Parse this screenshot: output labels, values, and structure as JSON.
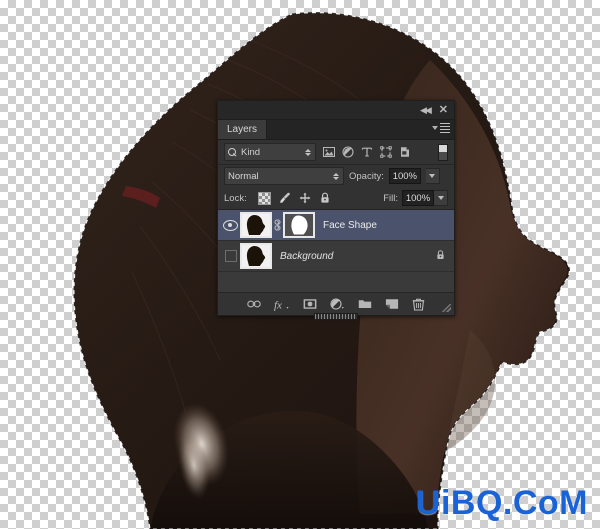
{
  "canvas": {
    "background": "transparent-checkerboard",
    "selection": "marching-ants",
    "subject": "woman-profile-silhouette",
    "watermark": "UiBQ.CoM",
    "watermark_color": "#1a63d6"
  },
  "panel": {
    "titlebar": {
      "collapse_label": "◀◀",
      "close_label": "✕"
    },
    "tab": {
      "label": "Layers"
    },
    "menu": {
      "label": "panel-menu"
    },
    "filter": {
      "kind_label": "Kind",
      "icons": [
        "pixel-layer-filter-icon",
        "adjustment-layer-filter-icon",
        "type-layer-filter-icon",
        "shape-layer-filter-icon",
        "smart-object-filter-icon"
      ],
      "toggle_label": "filter-enable-toggle"
    },
    "blend": {
      "mode": "Normal",
      "opacity_label": "Opacity:",
      "opacity_value": "100%"
    },
    "lock": {
      "label": "Lock:",
      "icons": [
        "lock-transparent-pixels-icon",
        "lock-image-pixels-icon",
        "lock-position-icon",
        "lock-all-icon"
      ],
      "fill_label": "Fill:",
      "fill_value": "100%"
    },
    "layers": [
      {
        "name": "Face Shape",
        "visible": true,
        "selected": true,
        "italic": false,
        "has_mask": true,
        "linked": true,
        "locked": false
      },
      {
        "name": "Background",
        "visible": false,
        "selected": false,
        "italic": true,
        "has_mask": false,
        "linked": false,
        "locked": true
      }
    ],
    "bottom_toolbar": [
      "link-layers-icon",
      "layer-style-fx-icon",
      "add-layer-mask-icon",
      "new-adjustment-layer-icon",
      "new-group-icon",
      "new-layer-icon",
      "delete-layer-icon"
    ],
    "colors": {
      "panel_bg": "#323232",
      "list_bg": "#3a3a3a",
      "selected_row": "#4a536b",
      "text": "#c7c7c7"
    }
  }
}
